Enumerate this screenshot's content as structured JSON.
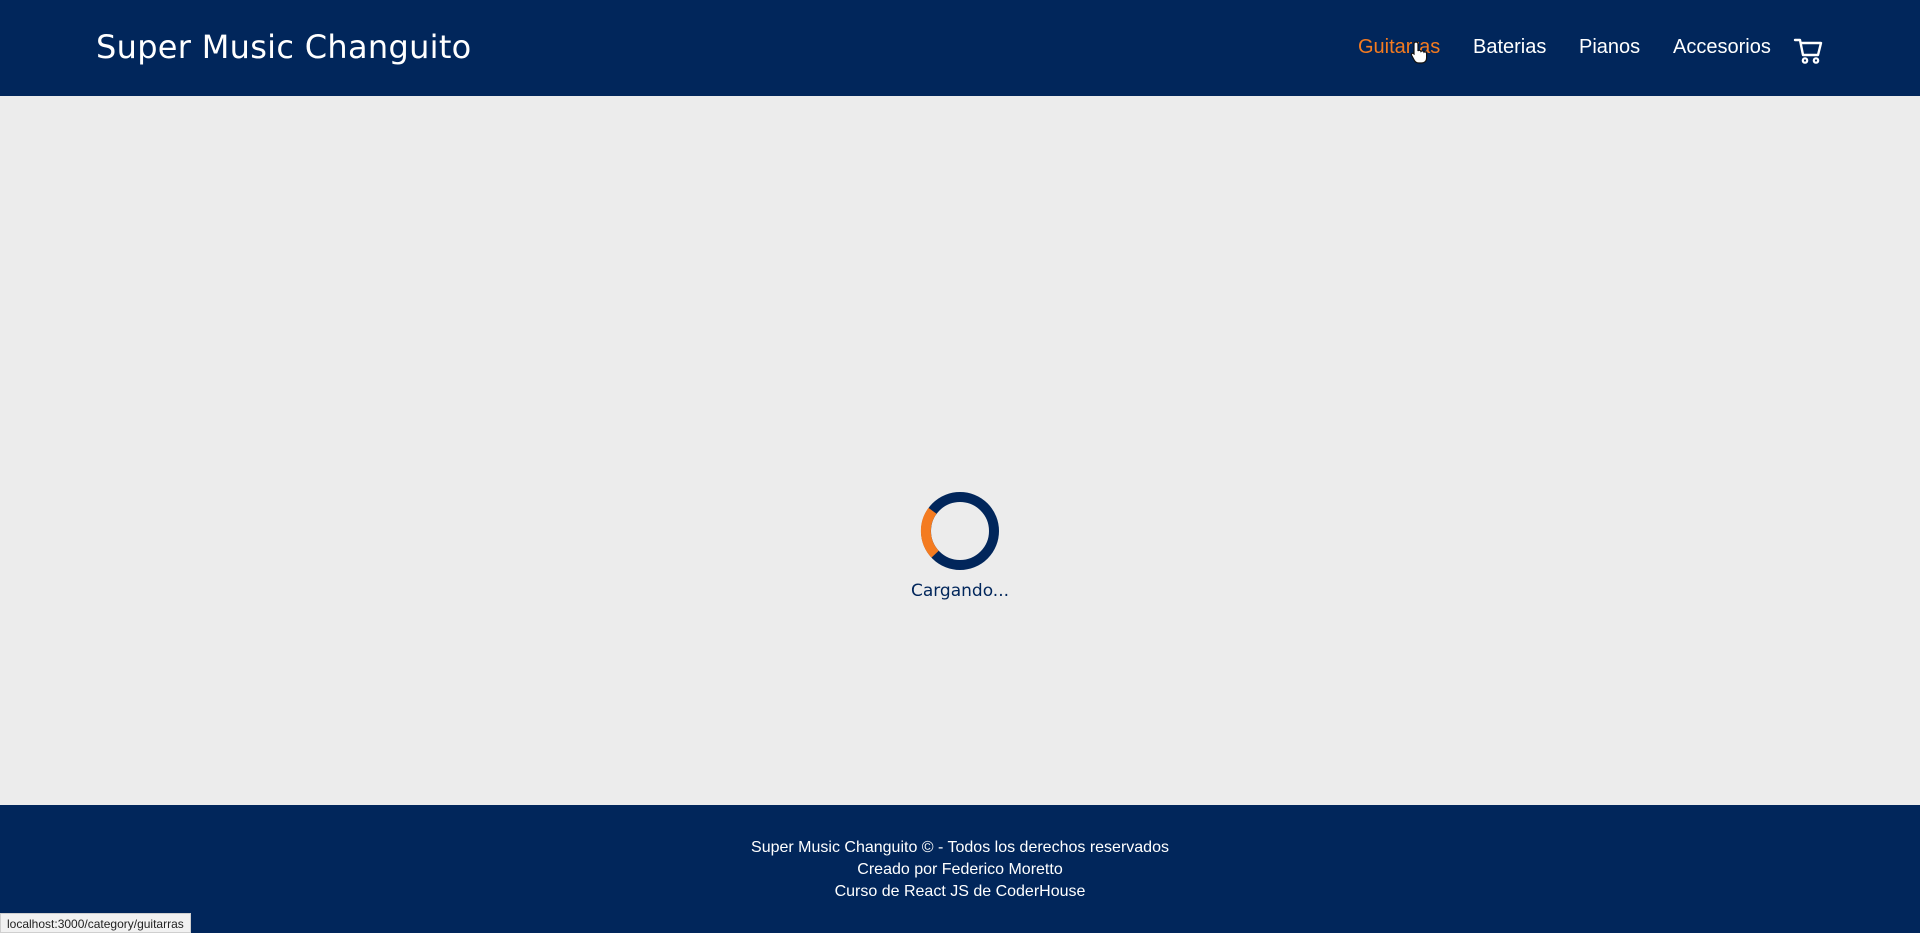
{
  "colors": {
    "header_bg": "#01265b",
    "accent": "#f47b20",
    "page_bg": "#ececec",
    "text_light": "#ffffff"
  },
  "header": {
    "brand": "Super Music Changuito",
    "nav": [
      {
        "label": "Guitarras",
        "active": true
      },
      {
        "label": "Baterias",
        "active": false
      },
      {
        "label": "Pianos",
        "active": false
      },
      {
        "label": "Accesorios",
        "active": false
      }
    ],
    "cart_icon": "cart-icon"
  },
  "main": {
    "loading_text": "Cargando..."
  },
  "footer": {
    "line1": "Super Music Changuito © - Todos los derechos reservados",
    "line2": "Creado por Federico Moretto",
    "line3": "Curso de React JS de CoderHouse"
  },
  "status_bar": {
    "url": "localhost:3000/category/guitarras"
  }
}
